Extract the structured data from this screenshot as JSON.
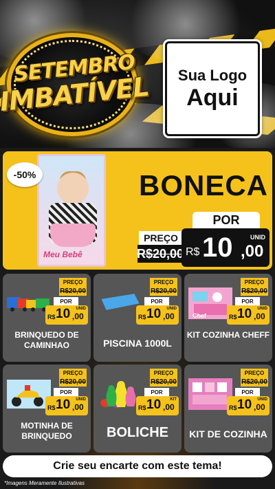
{
  "header": {
    "badge_line1": "SETEMBRO",
    "badge_line2": "IMBATÍVEL",
    "logo_line1": "Sua Logo",
    "logo_line2": "Aqui"
  },
  "hero": {
    "discount": "-50%",
    "name": "BONECA",
    "image_caption": "Meu Bebê",
    "preco_label": "PREÇO",
    "old_price": "R$20,00",
    "por_label": "POR",
    "currency": "R$",
    "price_int": "10",
    "price_dec": ",00",
    "unit": "UNID"
  },
  "products": [
    {
      "name": "BRINQUEDO DE CAMINHAO",
      "preco_label": "PREÇO",
      "old_price": "R$20,00",
      "por_label": "POR",
      "currency": "R$",
      "price_int": "10",
      "price_dec": ",00",
      "unit": "UNID",
      "icon": "toy-trucks-icon"
    },
    {
      "name": "PISCINA 1000L",
      "preco_label": "PREÇO",
      "old_price": "R$20,00",
      "por_label": "POR",
      "currency": "R$",
      "price_int": "10",
      "price_dec": ",00",
      "unit": "UNID",
      "icon": "pool-icon"
    },
    {
      "name": "KIT COZINHA CHEFF",
      "preco_label": "PREÇO",
      "old_price": "R$20,00",
      "por_label": "POR",
      "currency": "R$",
      "price_int": "10",
      "price_dec": ",00",
      "unit": "UNID",
      "icon": "kitchen-kit-icon",
      "image_text": "Chef"
    },
    {
      "name": "MOTINHA DE BRINQUEDO",
      "preco_label": "PREÇO",
      "old_price": "R$20,00",
      "por_label": "POR",
      "currency": "R$",
      "price_int": "10",
      "price_dec": ",00",
      "unit": "UNID",
      "icon": "toy-motorcycle-icon"
    },
    {
      "name": "BOLICHE",
      "preco_label": "PREÇO",
      "old_price": "R$20,00",
      "por_label": "POR",
      "currency": "R$",
      "price_int": "10",
      "price_dec": ",00",
      "unit": "KIT",
      "icon": "bowling-icon"
    },
    {
      "name": "KIT DE COZINHA",
      "preco_label": "PREÇO",
      "old_price": "R$20,00",
      "por_label": "POR",
      "currency": "R$",
      "price_int": "10",
      "price_dec": ",00",
      "unit": "UNID",
      "icon": "kitchen-set-icon"
    }
  ],
  "cta": "Crie seu encarte com este tema!",
  "footnote": "*Imagens Meramente Ilustrativas",
  "colors": {
    "accent": "#f5c21b",
    "dark": "#111111",
    "card": "#565656"
  }
}
